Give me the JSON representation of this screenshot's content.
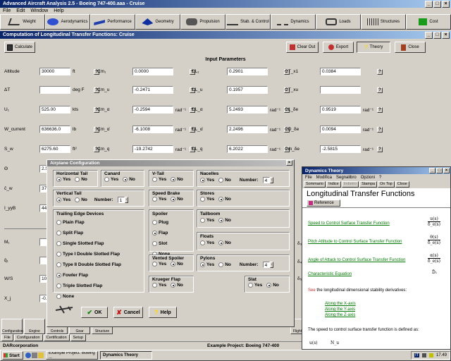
{
  "app": {
    "title": "Advanced Aircraft Analysis 2.5 - Boeing 747-400.aaa - Cruise",
    "menu": [
      "File",
      "Edit",
      "Window",
      "Help"
    ]
  },
  "modules": [
    {
      "label": "Weight",
      "icon": "weight-icon"
    },
    {
      "label": "Aerodynamics",
      "icon": "aerodynamics-icon"
    },
    {
      "label": "Performance",
      "icon": "performance-icon"
    },
    {
      "label": "Geometry",
      "icon": "geometry-icon"
    },
    {
      "label": "Propulsion",
      "icon": "propulsion-icon"
    },
    {
      "label": "Stab. & Control",
      "icon": "stab-control-icon"
    },
    {
      "label": "Dynamics",
      "icon": "dynamics-icon"
    },
    {
      "label": "Loads",
      "icon": "loads-icon"
    },
    {
      "label": "Structures",
      "icon": "structures-icon"
    },
    {
      "label": "Cost",
      "icon": "cost-icon"
    }
  ],
  "subwindow": {
    "title": "Computation of Longitudinal Transfer Functions: Cruise",
    "calculate": "Calculate",
    "clear_out": "Clear Out",
    "export": "Export",
    "theory": "Theory",
    "close": "Close",
    "section_title": "Input Parameters"
  },
  "inputs": {
    "col1": [
      {
        "label": "Altitude",
        "value": "30000",
        "unit": "ft"
      },
      {
        "label": "ΔT",
        "value": "",
        "unit": "deg F"
      },
      {
        "label": "U₁",
        "value": "525.00",
        "unit": "kts"
      },
      {
        "label": "W_current",
        "value": "636636.0",
        "unit": "lb"
      },
      {
        "label": "S_w",
        "value": "6275.60",
        "unit": "ft²"
      },
      {
        "label": "Θ",
        "value": "2.5",
        "unit": ""
      },
      {
        "label": "c̄_w",
        "value": "37",
        "unit": ""
      },
      {
        "label": "I_yyB",
        "value": "44",
        "unit": ""
      },
      {
        "label": "M₁",
        "value": "",
        "unit": ""
      },
      {
        "label": "q̄₁",
        "value": "",
        "unit": ""
      },
      {
        "label": "W/S",
        "value": "10",
        "unit": ""
      },
      {
        "label": "X_j",
        "value": "-0.",
        "unit": ""
      }
    ],
    "col2": [
      {
        "label": "Cm₁",
        "value": "0.0000",
        "unit": ""
      },
      {
        "label": "Cm_u",
        "value": "-0.2471",
        "unit": ""
      },
      {
        "label": "Cm_α",
        "value": "-0.2594",
        "unit": "rad⁻¹"
      },
      {
        "label": "Cm_α̇",
        "value": "-6.1008",
        "unit": "rad⁻¹"
      },
      {
        "label": "Cm_q",
        "value": "-19.2742",
        "unit": "rad⁻¹"
      }
    ],
    "col3": [
      {
        "label": "CL₁",
        "value": "0.2901",
        "unit": ""
      },
      {
        "label": "CL_u",
        "value": "0.1957",
        "unit": ""
      },
      {
        "label": "CL_α",
        "value": "5.2493",
        "unit": "rad⁻¹"
      },
      {
        "label": "CL_α̇",
        "value": "2.2496",
        "unit": "rad⁻¹"
      },
      {
        "label": "CL_q",
        "value": "6.2022",
        "unit": "rad⁻¹"
      }
    ],
    "col4": [
      {
        "label": "CT_x1",
        "value": "0.0384",
        "unit": ""
      },
      {
        "label": "CT_xu",
        "value": "",
        "unit": ""
      },
      {
        "label": "CL_δe",
        "value": "0.9519",
        "unit": "rad⁻¹"
      },
      {
        "label": "CD_δe",
        "value": "0.0094",
        "unit": "rad⁻¹"
      },
      {
        "label": "Cm_δe",
        "value": "-2.5815",
        "unit": "rad⁻¹"
      }
    ],
    "extra_right": [
      "δ₃",
      "δ₄",
      "δ₅"
    ]
  },
  "airplane_config": {
    "title": "Airplane Configuration",
    "groups": {
      "horizontal_tail": {
        "title": "Horizontal Tail",
        "yes": "Yes",
        "no": "No",
        "selected": "yes"
      },
      "canard": {
        "title": "Canard",
        "yes": "Yes",
        "no": "No",
        "selected": "no"
      },
      "vtail": {
        "title": "V-Tail",
        "yes": "Yes",
        "no": "No",
        "selected": "no"
      },
      "nacelles": {
        "title": "Nacelles",
        "yes": "Yes",
        "no": "No",
        "selected": "yes",
        "number_label": "Number:",
        "number": "4"
      },
      "vertical_tail": {
        "title": "Vertical Tail",
        "yes": "Yes",
        "no": "No",
        "selected": "yes",
        "number_label": "Number:",
        "number": "1"
      },
      "speed_brake": {
        "title": "Speed Brake",
        "yes": "Yes",
        "no": "No",
        "selected": "no"
      },
      "stores": {
        "title": "Stores",
        "yes": "Yes",
        "no": "No",
        "selected": "no"
      },
      "trailing_edge": {
        "title": "Trailing Edge Devices",
        "options": [
          "Plain Flap",
          "Split Flap",
          "Single Slotted Flap",
          "Type I Double Slotted Flap",
          "Type II Double Slotted Flap",
          "Fowler Flap",
          "Triple Slotted Flap",
          "None"
        ],
        "selected": 5
      },
      "spoiler": {
        "title": "Spoiler",
        "options": [
          "Plug",
          "Flap",
          "Slot",
          "None"
        ],
        "selected": 1
      },
      "tailboom": {
        "title": "Tailboom",
        "yes": "Yes",
        "no": "No",
        "selected": "no"
      },
      "floats": {
        "title": "Floats",
        "yes": "Yes",
        "no": "No",
        "selected": "no"
      },
      "vented_spoiler": {
        "title": "Vented Spoiler",
        "yes": "Yes",
        "no": "No",
        "selected": "no"
      },
      "pylons": {
        "title": "Pylons",
        "yes": "Yes",
        "no": "No",
        "selected": "yes",
        "number_label": "Number:",
        "number": "4"
      },
      "krueger_flap": {
        "title": "Krueger Flap",
        "yes": "Yes",
        "no": "No",
        "selected": "no"
      },
      "slat": {
        "title": "Slat",
        "yes": "Yes",
        "no": "No",
        "selected": "no"
      }
    },
    "ok": "OK",
    "cancel": "Cancel",
    "help": "Help"
  },
  "bottom_tabs": {
    "icons": [
      "Configuration",
      "Engine",
      "Controls",
      "Gear",
      "Structure"
    ],
    "tabs": [
      "File",
      "Configuration",
      "Certification",
      "Setup"
    ],
    "flight": "Flight",
    "company": "DARcorporation",
    "project": "Example Project: Boeing 747-400"
  },
  "theory": {
    "title": "Dynamics Theory",
    "menu": [
      "File",
      "Modifica",
      "Segnalibro",
      "Opzioni",
      "?"
    ],
    "buttons": [
      "Sommario",
      "Indice",
      "Indietro",
      "Stampa",
      "On Top",
      "Close"
    ],
    "heading": "Longitudinal Transfer Functions",
    "reference": "Reference",
    "links": [
      {
        "text": "Speed to Control Surface Transfer Function",
        "num": "u(s)",
        "den": "δ_e(s)"
      },
      {
        "text": "Pitch Attitude to Control Surface Transfer Function",
        "num": "θ(s)",
        "den": "δ_e(s)"
      },
      {
        "text": "Angle of Attack to Control Surface Transfer Function",
        "num": "α(s)",
        "den": "δ_e(s)"
      },
      {
        "text": "Characteristic Equation",
        "num": "D̄₁",
        "den": ""
      }
    ],
    "see_prefix": "See",
    "see_text": " the longitudinal dimensional stability derivatives:",
    "axes": [
      "Along the X-axis",
      "Along the Y-axis",
      "Along the Z-axis"
    ],
    "speed_text": "The speed to control surface transfer function is defined as:",
    "formula_left": "u(s)",
    "formula_right": "N_u"
  },
  "taskbar": {
    "start": "Start",
    "tasks": [
      "Example Project: Boeing ...",
      "Dynamics Theory"
    ],
    "lang": "IT",
    "time": "17.49"
  },
  "colors": {
    "titlebar": "#0a246a",
    "desktop": "#008080",
    "face": "#d4d0c8",
    "link": "#007700"
  }
}
